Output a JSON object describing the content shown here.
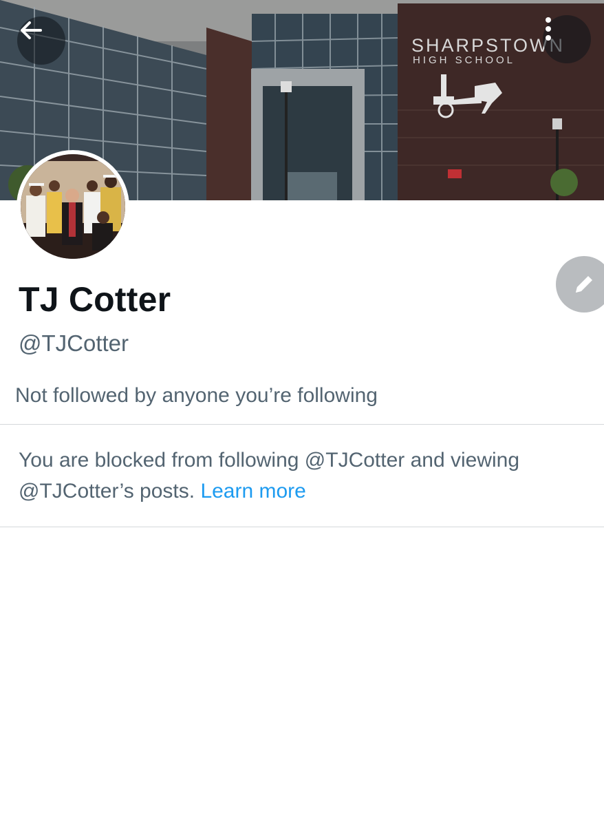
{
  "header": {
    "banner_sign_line1": "SHARPSTOWN",
    "banner_sign_line2": "HIGH SCHOOL"
  },
  "profile": {
    "display_name": "TJ Cotter",
    "handle": "@TJCotter",
    "followed_by": "Not followed by anyone you’re following"
  },
  "blocked_notice": {
    "message": "You are blocked from following @TJCotter and viewing @TJCotter’s posts.",
    "learn_more": "Learn more"
  },
  "icons": {
    "back": "arrow-left-icon",
    "more": "vertical-dots-icon",
    "edit": "pencil-icon"
  },
  "colors": {
    "link": "#1d9bf0",
    "secondary_text": "#536471",
    "primary_text": "#0f1419",
    "divider": "#d4d8db",
    "edit_button": "#b9bcbf"
  }
}
